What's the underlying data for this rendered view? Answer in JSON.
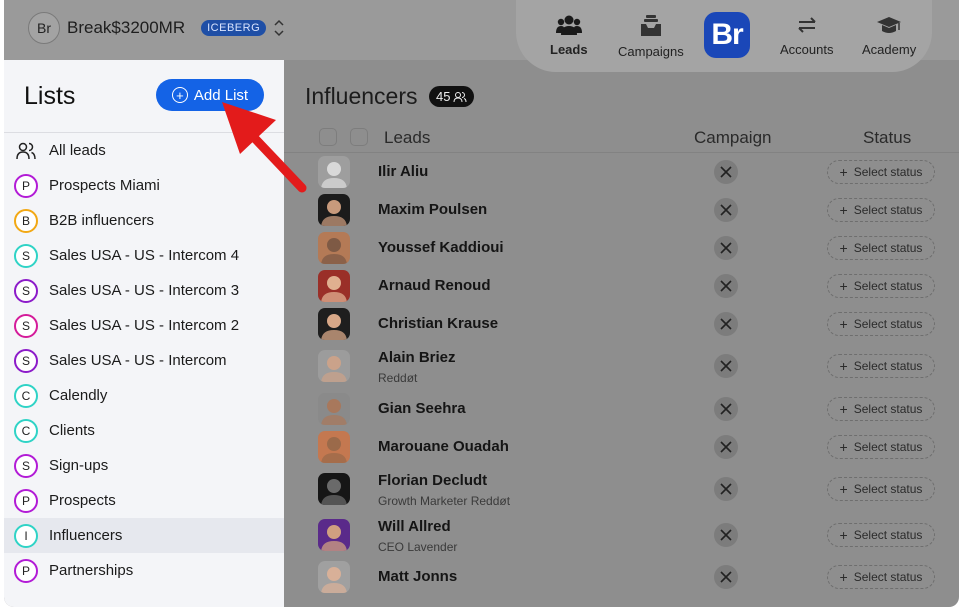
{
  "account": {
    "initials": "Br",
    "name": "Break$3200MR",
    "badge": "ICEBERG"
  },
  "nav": {
    "items": [
      {
        "label": "Leads",
        "icon": "users-icon",
        "active": true
      },
      {
        "label": "Campaigns",
        "icon": "inbox-icon",
        "active": false
      },
      {
        "label": "Accounts",
        "icon": "swap-arrows-icon",
        "active": false
      },
      {
        "label": "Academy",
        "icon": "graduation-cap-icon",
        "active": false
      }
    ],
    "brand_logo": "Br"
  },
  "sidebar": {
    "title": "Lists",
    "add_button": "Add List",
    "items": [
      {
        "label": "All leads",
        "letter": "",
        "color": ""
      },
      {
        "label": "Prospects Miami",
        "letter": "P",
        "color": "#b21bd6"
      },
      {
        "label": "B2B influencers",
        "letter": "B",
        "color": "#f2a814"
      },
      {
        "label": "Sales USA - US - Intercom 4",
        "letter": "S",
        "color": "#2fd3c6"
      },
      {
        "label": "Sales USA - US - Intercom 3",
        "letter": "S",
        "color": "#8c1bc9"
      },
      {
        "label": "Sales USA - US - Intercom 2",
        "letter": "S",
        "color": "#d41b9a"
      },
      {
        "label": "Sales USA - US - Intercom",
        "letter": "S",
        "color": "#8c1bc9"
      },
      {
        "label": "Calendly",
        "letter": "C",
        "color": "#2fd3c6"
      },
      {
        "label": "Clients",
        "letter": "C",
        "color": "#2fd3c6"
      },
      {
        "label": "Sign-ups",
        "letter": "S",
        "color": "#b21bd6"
      },
      {
        "label": "Prospects",
        "letter": "P",
        "color": "#b21bd6"
      },
      {
        "label": "Influencers",
        "letter": "I",
        "color": "#2fd3c6",
        "active": true
      },
      {
        "label": "Partnerships",
        "letter": "P",
        "color": "#b21bd6"
      }
    ]
  },
  "main": {
    "title": "Influencers",
    "count": "45",
    "columns": {
      "leads": "Leads",
      "campaign": "Campaign",
      "status": "Status"
    },
    "status_button": "Select status",
    "rows": [
      {
        "name": "Ilir Aliu",
        "sub": "",
        "skin": "#d9d9d9",
        "bg": "#9e9e9e"
      },
      {
        "name": "Maxim Poulsen",
        "sub": "",
        "skin": "#c89a7c",
        "bg": "#1b1b1b"
      },
      {
        "name": "Youssef Kaddioui",
        "sub": "",
        "skin": "#7e5a45",
        "bg": "#b47a56"
      },
      {
        "name": "Arnaud Renoud",
        "sub": "",
        "skin": "#e0b090",
        "bg": "#9a2f28"
      },
      {
        "name": "Christian Krause",
        "sub": "",
        "skin": "#d8a888",
        "bg": "#1e1e1e"
      },
      {
        "name": "Alain Briez",
        "sub": "Reddøt",
        "skin": "#caa28a",
        "bg": "#9c9c9c"
      },
      {
        "name": "Gian Seehra",
        "sub": "",
        "skin": "#a8785c",
        "bg": "#8a8a8a"
      },
      {
        "name": "Marouane Ouadah",
        "sub": "",
        "skin": "#9b6a4a",
        "bg": "#c47850"
      },
      {
        "name": "Florian Decludt",
        "sub": "Growth Marketer Reddøt",
        "skin": "#6a6a6a",
        "bg": "#161616"
      },
      {
        "name": "Will Allred",
        "sub": "CEO Lavender",
        "skin": "#d0a080",
        "bg": "#5a2a8a"
      },
      {
        "name": "Matt Jonns",
        "sub": "",
        "skin": "#d8b098",
        "bg": "#a0a0a0"
      }
    ]
  }
}
